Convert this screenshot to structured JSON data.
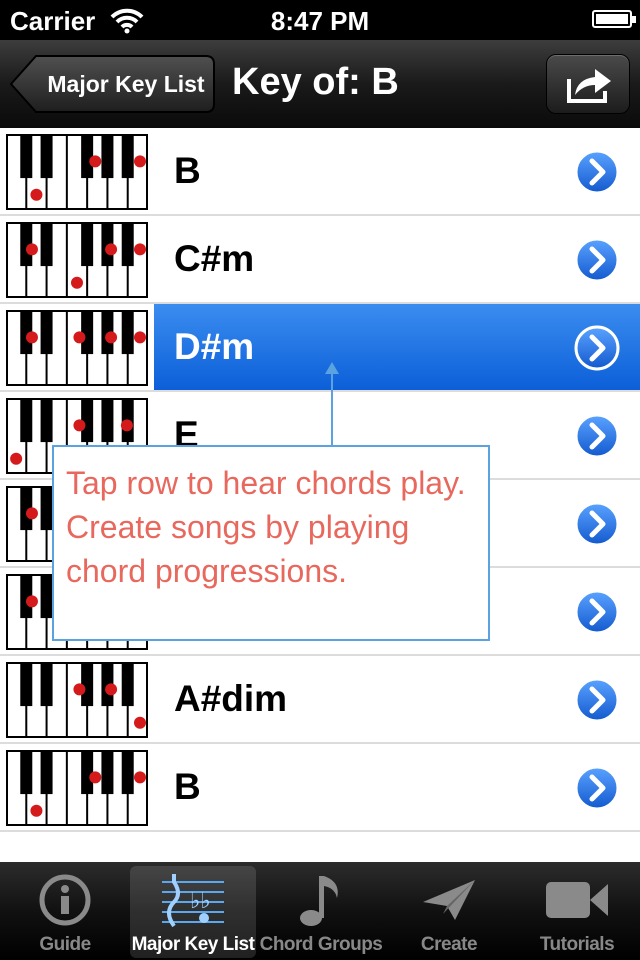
{
  "status_bar": {
    "carrier": "Carrier",
    "time": "8:47 PM"
  },
  "nav": {
    "back_label": "Major Key List",
    "title": "Key of: B"
  },
  "rows": [
    {
      "label": "B",
      "selected": false
    },
    {
      "label": "C#m",
      "selected": false
    },
    {
      "label": "D#m",
      "selected": true
    },
    {
      "label": "E",
      "selected": false
    },
    {
      "label": "",
      "selected": false
    },
    {
      "label": "",
      "selected": false
    },
    {
      "label": "A#dim",
      "selected": false
    },
    {
      "label": "B",
      "selected": false
    }
  ],
  "callout": {
    "text": "Tap row to hear chords play. Create songs by playing chord progressions."
  },
  "tabs": [
    {
      "label": "Guide",
      "icon": "info-icon",
      "active": false
    },
    {
      "label": "Major Key List",
      "icon": "music-staff-icon",
      "active": true
    },
    {
      "label": "Chord Groups",
      "icon": "music-note-icon",
      "active": false
    },
    {
      "label": "Create",
      "icon": "paper-plane-icon",
      "active": false
    },
    {
      "label": "Tutorials",
      "icon": "video-camera-icon",
      "active": false
    }
  ],
  "colors": {
    "selection": "#1a6fe0",
    "callout_text": "#e8685d",
    "callout_border": "#5aa2e0"
  }
}
